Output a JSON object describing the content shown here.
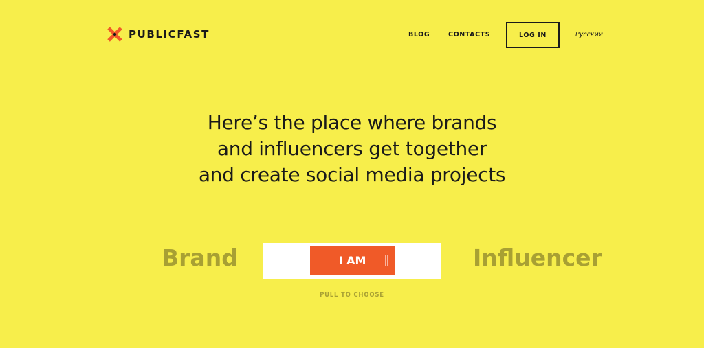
{
  "brand": {
    "name": "PUBLICFAST",
    "accent_color": "#f05a28"
  },
  "header": {
    "nav": [
      {
        "label": "BLOG"
      },
      {
        "label": "CONTACTS"
      }
    ],
    "login_label": "LOG IN",
    "language_label": "Русский"
  },
  "hero": {
    "lines": [
      "Here’s the place where brands",
      "and influencers get together",
      "and create social media projects"
    ]
  },
  "chooser": {
    "left_option": "Brand",
    "right_option": "Influencer",
    "slider_label": "I AM",
    "hint": "PULL TO CHOOSE"
  },
  "colors": {
    "background": "#f7ee4b",
    "muted_text": "#a8a033",
    "track": "#ffffff"
  }
}
